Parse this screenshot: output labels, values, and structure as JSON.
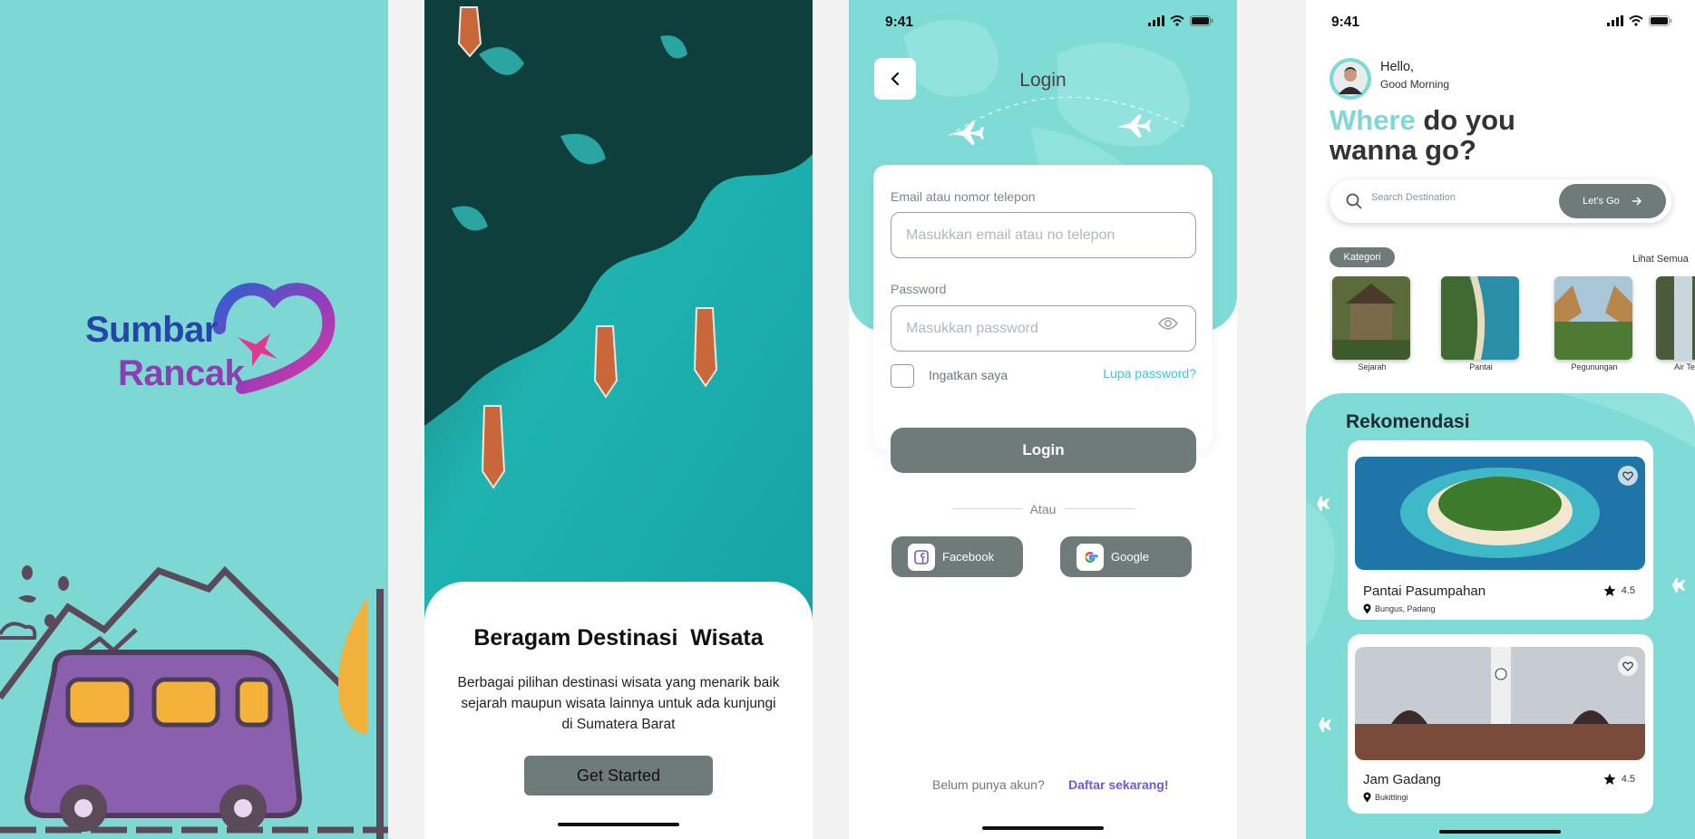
{
  "splash": {
    "logo_line1": "Sumbar",
    "logo_line2": "Rancak"
  },
  "onboarding": {
    "title": "Beragam Destinasi  Wisata",
    "description": "Berbagai pilihan destinasi wisata yang menarik baik sejarah maupun wisata lainnya untuk ada kunjungi di Sumatera Barat",
    "cta_label": "Get Started"
  },
  "login": {
    "status_time": "9:41",
    "title": "Login",
    "email_label": "Email atau nomor telepon",
    "email_placeholder": "Masukkan email atau no telepon",
    "password_label": "Password",
    "password_placeholder": "Masukkan password",
    "remember_label": "Ingatkan saya",
    "forgot_label": "Lupa password?",
    "login_button": "Login",
    "or_label": "Atau",
    "facebook_label": "Facebook",
    "google_label": "Google",
    "no_account": "Belum punya akun?",
    "signup_link": "Daftar sekarang!"
  },
  "home": {
    "status_time": "9:41",
    "hello": "Hello,",
    "greeting": "Good Morning",
    "headline_highlight": "Where",
    "headline_rest1": " do you",
    "headline_rest2": "wanna go?",
    "search_placeholder": "Search Destination",
    "go_button": "Let's Go",
    "category_badge": "Kategori",
    "see_all": "Lihat Semua",
    "categories": [
      {
        "label": "Sejarah"
      },
      {
        "label": "Pantai"
      },
      {
        "label": "Pegunungan"
      },
      {
        "label": "Air Te"
      }
    ],
    "recommend_title": "Rekomendasi",
    "recommendations": [
      {
        "name": "Pantai Pasumpahan",
        "location": "Bungus, Padang",
        "rating": "4.5"
      },
      {
        "name": "Jam Gadang",
        "location": "Bukittingi",
        "rating": "4.5"
      }
    ]
  },
  "colors": {
    "teal": "#7dd8d4",
    "button_gray": "#6f7b79",
    "link_cyan": "#3fc7d0",
    "link_purple": "#6a5ae0",
    "van_purple": "#8a5fae"
  }
}
